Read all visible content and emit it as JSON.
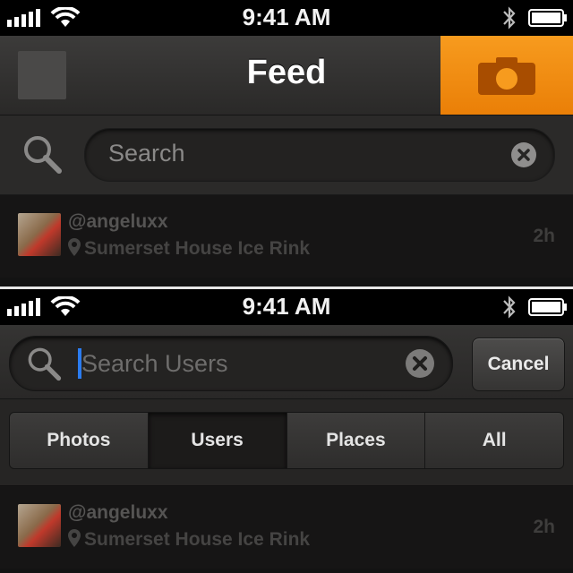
{
  "screen1": {
    "status": {
      "time": "9:41 AM"
    },
    "nav": {
      "title": "Feed"
    },
    "search": {
      "placeholder": "Search"
    },
    "feed_item": {
      "username": "@angeluxx",
      "location": "Sumerset House Ice Rink",
      "time": "2h"
    }
  },
  "screen2": {
    "status": {
      "time": "9:41 AM"
    },
    "search": {
      "placeholder": "Search Users",
      "cancel_label": "Cancel"
    },
    "segments": [
      {
        "label": "Photos",
        "active": false
      },
      {
        "label": "Users",
        "active": true
      },
      {
        "label": "Places",
        "active": false
      },
      {
        "label": "All",
        "active": false
      }
    ],
    "feed_item": {
      "username": "@angeluxx",
      "location": "Sumerset House Ice Rink",
      "time": "2h"
    }
  },
  "colors": {
    "accent_orange": "#f08a12",
    "caret_blue": "#2b7cf0",
    "divider": "#e6e6e6"
  },
  "icons": [
    "signal-icon",
    "wifi-icon",
    "bluetooth-icon",
    "battery-icon",
    "camera-icon",
    "search-icon",
    "clear-icon",
    "location-pin-icon"
  ]
}
